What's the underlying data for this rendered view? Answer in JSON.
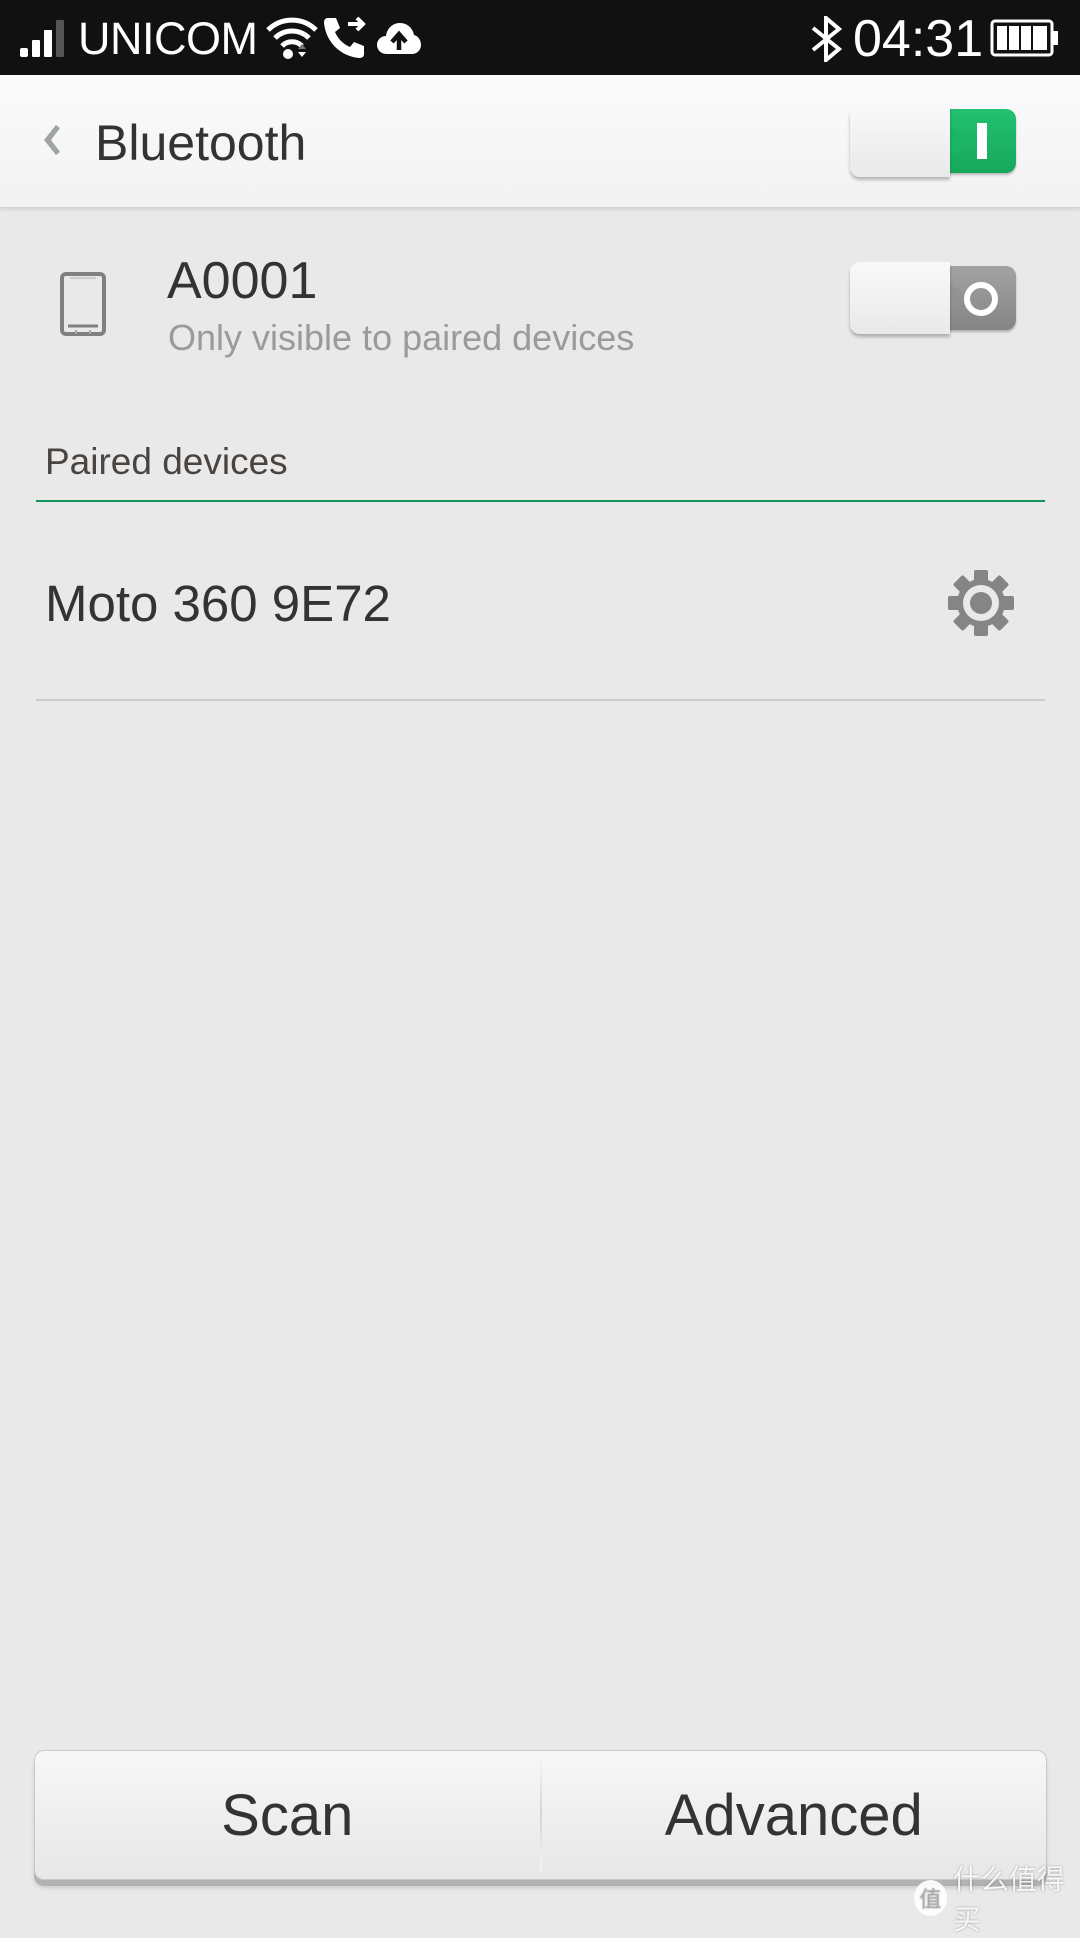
{
  "status_bar": {
    "carrier": "UNICOM",
    "time": "04:31",
    "icons": [
      "signal-icon",
      "wifi-icon",
      "call-forward-icon",
      "cloud-upload-icon",
      "bluetooth-icon",
      "battery-icon"
    ]
  },
  "header": {
    "title": "Bluetooth",
    "back_icon": "chevron-left-icon",
    "bluetooth_toggle": {
      "state": "on",
      "label": "I"
    }
  },
  "this_device": {
    "icon": "phone-icon",
    "name": "A0001",
    "visibility": "Only visible to paired devices",
    "visibility_toggle": {
      "state": "off",
      "label": "O"
    }
  },
  "paired_section": {
    "label": "Paired devices",
    "devices": [
      {
        "name": "Moto 360 9E72",
        "settings_icon": "gear-icon"
      }
    ]
  },
  "bottom_bar": {
    "scan_label": "Scan",
    "advanced_label": "Advanced"
  },
  "watermark": {
    "text": "什么值得买",
    "badge": "值"
  },
  "colors": {
    "accent_green": "#1cb566",
    "status_bar_bg": "#111111",
    "page_bg": "#e9e9e9",
    "toggle_off": "#929292"
  }
}
